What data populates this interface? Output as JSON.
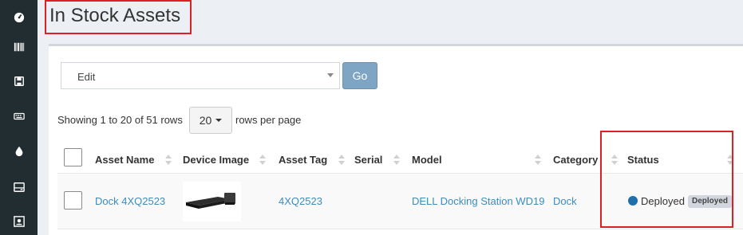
{
  "sidebar": {
    "items": [
      {
        "icon": "dashboard-icon"
      },
      {
        "icon": "barcode-icon"
      },
      {
        "icon": "save-icon"
      },
      {
        "icon": "keyboard-icon"
      },
      {
        "icon": "drop-icon"
      },
      {
        "icon": "hdd-icon"
      },
      {
        "icon": "user-card-icon"
      }
    ]
  },
  "header": {
    "title": "In Stock Assets"
  },
  "toolbar": {
    "bulk_action_value": "Edit",
    "go_label": "Go"
  },
  "pagination": {
    "showing_text": "Showing 1 to 20 of 51 rows",
    "page_size": "20",
    "rows_per_page_label": "rows per page"
  },
  "table": {
    "columns": [
      "Asset Name",
      "Device Image",
      "Asset Tag",
      "Serial",
      "Model",
      "Category",
      "Status"
    ],
    "rows": [
      {
        "asset_name": "Dock 4XQ2523",
        "asset_tag": "4XQ2523",
        "serial": "",
        "model": "DELL Docking Station WD19",
        "category": "Dock",
        "status": "Deployed",
        "status_badge": "Deployed"
      }
    ]
  },
  "colors": {
    "sidebar": "#222d32",
    "link": "#3c8dbc",
    "highlight": "#dd1f26",
    "go_button": "#7ea5c3",
    "status_dot": "#1f6fad"
  }
}
